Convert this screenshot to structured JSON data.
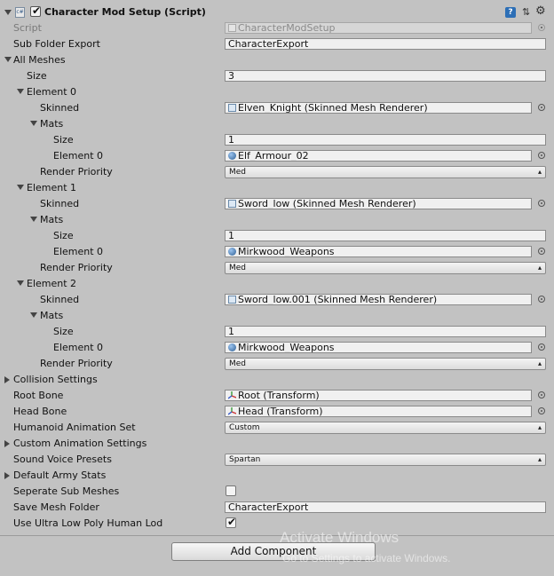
{
  "header": {
    "title": "Character Mod Setup (Script)",
    "enabled": true
  },
  "script_row": {
    "label": "Script",
    "value": "CharacterModSetup"
  },
  "sub_folder_export": {
    "label": "Sub Folder Export",
    "value": "CharacterExport"
  },
  "all_meshes": {
    "label": "All Meshes",
    "size_label": "Size",
    "size_value": "3",
    "elements": [
      {
        "label": "Element 0",
        "skinned_label": "Skinned",
        "skinned_value": "Elven_Knight (Skinned Mesh Renderer)",
        "mats_label": "Mats",
        "mats_size_label": "Size",
        "mats_size_value": "1",
        "mat_element_label": "Element 0",
        "mat_element_value": "Elf_Armour_02",
        "render_priority_label": "Render Priority",
        "render_priority_value": "Med"
      },
      {
        "label": "Element 1",
        "skinned_label": "Skinned",
        "skinned_value": "Sword_low (Skinned Mesh Renderer)",
        "mats_label": "Mats",
        "mats_size_label": "Size",
        "mats_size_value": "1",
        "mat_element_label": "Element 0",
        "mat_element_value": "Mirkwood_Weapons",
        "render_priority_label": "Render Priority",
        "render_priority_value": "Med"
      },
      {
        "label": "Element 2",
        "skinned_label": "Skinned",
        "skinned_value": "Sword_low.001 (Skinned Mesh Renderer)",
        "mats_label": "Mats",
        "mats_size_label": "Size",
        "mats_size_value": "1",
        "mat_element_label": "Element 0",
        "mat_element_value": "Mirkwood_Weapons",
        "render_priority_label": "Render Priority",
        "render_priority_value": "Med"
      }
    ]
  },
  "collision_settings": {
    "label": "Collision Settings"
  },
  "root_bone": {
    "label": "Root Bone",
    "value": "Root (Transform)"
  },
  "head_bone": {
    "label": "Head Bone",
    "value": "Head (Transform)"
  },
  "humanoid_animation_set": {
    "label": "Humanoid Animation Set",
    "value": "Custom"
  },
  "custom_animation_settings": {
    "label": "Custom Animation Settings"
  },
  "sound_voice_presets": {
    "label": "Sound Voice Presets",
    "value": "Spartan"
  },
  "default_army_stats": {
    "label": "Default Army Stats"
  },
  "seperate_sub_meshes": {
    "label": "Seperate Sub Meshes",
    "checked": false
  },
  "save_mesh_folder": {
    "label": "Save Mesh Folder",
    "value": "CharacterExport"
  },
  "ultra_low_poly": {
    "label": "Use Ultra Low Poly Human Lod",
    "checked": true
  },
  "add_component": {
    "label": "Add Component"
  },
  "watermark": {
    "line1": "Activate Windows",
    "line2": "Go to Settings to activate Windows."
  },
  "icons": {
    "script_icon": "script-component-icon",
    "help_icon": "help-icon",
    "presets_icon": "presets-icon",
    "settings_icon": "gear-icon"
  },
  "colors": {
    "background": "#c2c2c2",
    "field": "#f0f0f0",
    "help_blue": "#2d6fb6"
  }
}
